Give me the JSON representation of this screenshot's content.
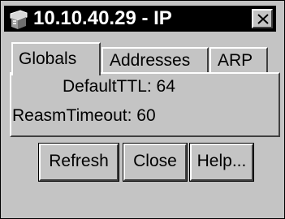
{
  "window": {
    "title": "10.10.40.29 - IP"
  },
  "tabs": [
    {
      "label": "Globals",
      "selected": true
    },
    {
      "label": "Addresses",
      "selected": false
    },
    {
      "label": "ARP",
      "selected": false
    }
  ],
  "fields": {
    "default_ttl": "DefaultTTL: 64",
    "reasm_timeout": "ReasmTimeout: 60"
  },
  "buttons": {
    "refresh": "Refresh",
    "close": "Close",
    "help": "Help..."
  },
  "icons": {
    "title_icon": "computer-icon",
    "close": "close-icon"
  }
}
